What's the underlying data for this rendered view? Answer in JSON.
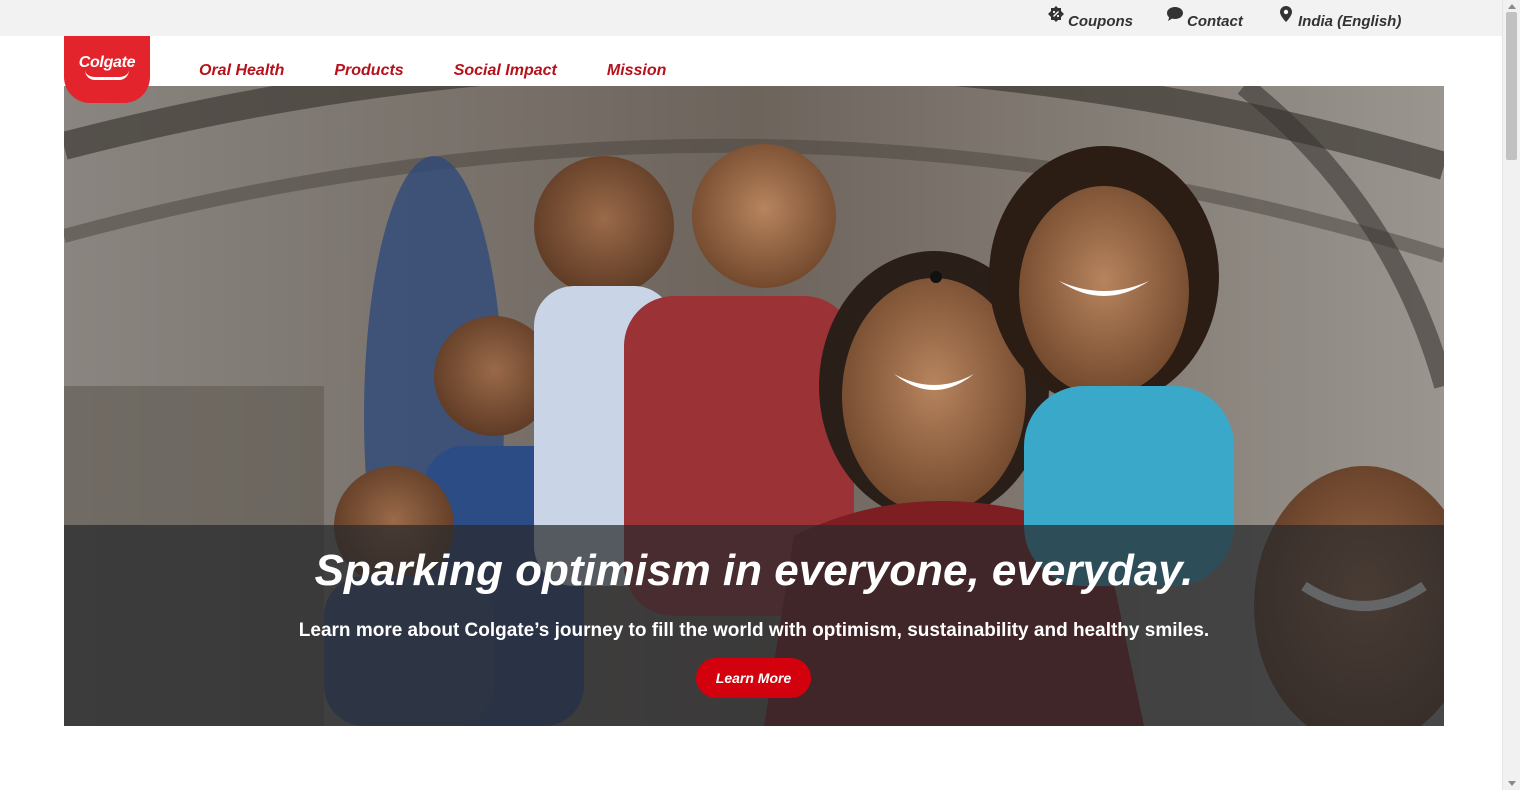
{
  "utility": {
    "coupons": {
      "label": "Coupons",
      "icon": "coupon-icon"
    },
    "contact": {
      "label": "Contact",
      "icon": "chat-bubble-icon"
    },
    "country": {
      "label": "India (English)",
      "icon": "location-pin-icon"
    }
  },
  "brand": {
    "logo_text": "Colgate",
    "color": "#e4242d"
  },
  "nav": {
    "items": [
      {
        "label": "Oral Health"
      },
      {
        "label": "Products"
      },
      {
        "label": "Social Impact"
      },
      {
        "label": "Mission"
      }
    ],
    "color": "#b5121b"
  },
  "hero": {
    "title": "Sparking optimism in everyone, everyday.",
    "subtitle": "Learn more about Colgate’s journey to fill the world with optimism, sustainability and healthy smiles.",
    "button_label": "Learn More",
    "button_color": "#d2010d"
  }
}
